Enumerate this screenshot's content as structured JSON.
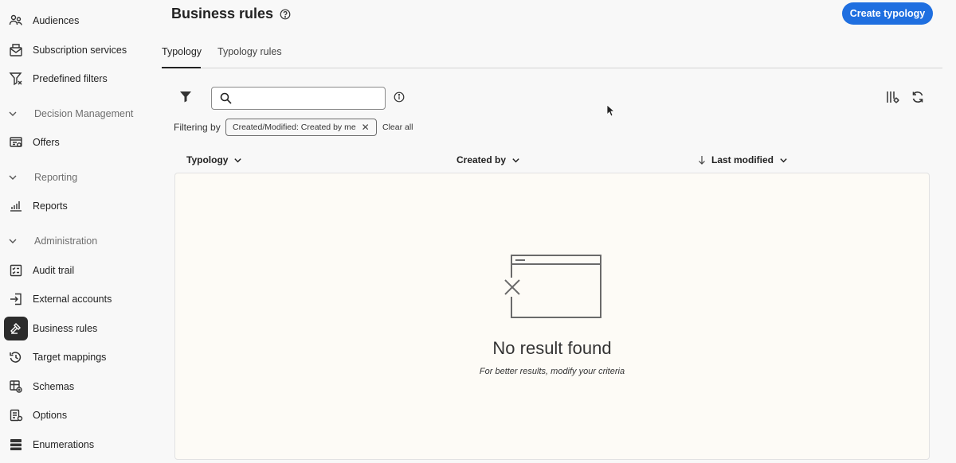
{
  "sidebar": {
    "items": [
      {
        "label": "Audiences",
        "icon": "audiences-icon"
      },
      {
        "label": "Subscription services",
        "icon": "subscription-icon"
      },
      {
        "label": "Predefined filters",
        "icon": "filter-icon"
      },
      {
        "label": "Offers",
        "icon": "offers-icon"
      },
      {
        "label": "Reports",
        "icon": "reports-icon"
      },
      {
        "label": "Audit trail",
        "icon": "audit-trail-icon"
      },
      {
        "label": "External accounts",
        "icon": "external-accounts-icon"
      },
      {
        "label": "Business rules",
        "icon": "business-rules-icon"
      },
      {
        "label": "Target mappings",
        "icon": "target-mappings-icon"
      },
      {
        "label": "Schemas",
        "icon": "schemas-icon"
      },
      {
        "label": "Options",
        "icon": "options-icon"
      },
      {
        "label": "Enumerations",
        "icon": "enumerations-icon"
      }
    ],
    "sections": [
      {
        "label": "Decision Management"
      },
      {
        "label": "Reporting"
      },
      {
        "label": "Administration"
      }
    ],
    "active": "Business rules"
  },
  "header": {
    "title": "Business rules",
    "create_label": "Create typology"
  },
  "tabs": [
    {
      "label": "Typology",
      "active": true
    },
    {
      "label": "Typology rules",
      "active": false
    }
  ],
  "search": {
    "value": "",
    "placeholder": ""
  },
  "filters": {
    "label": "Filtering by",
    "chips": [
      {
        "label": "Created/Modified: Created by me"
      }
    ],
    "clear_label": "Clear all"
  },
  "table": {
    "columns": [
      {
        "label": "Typology"
      },
      {
        "label": "Created by"
      },
      {
        "label": "Last modified",
        "sorted": "descending"
      }
    ],
    "rows": []
  },
  "empty_state": {
    "title": "No result found",
    "subtitle": "For better results, modify your criteria"
  },
  "colors": {
    "accent": "#1f6fe0",
    "active_nav_bg": "#2c2c2c",
    "results_bg": "#fdfbf6"
  }
}
